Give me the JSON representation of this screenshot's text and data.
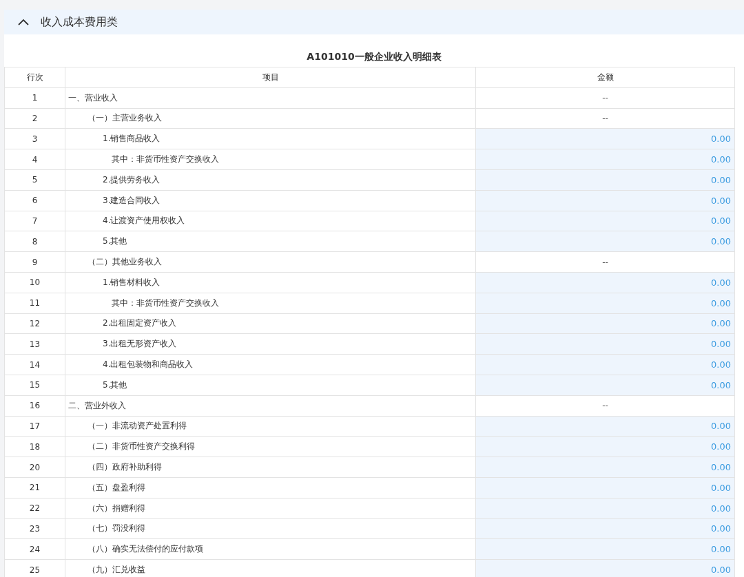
{
  "section": {
    "title": "收入成本费用类",
    "expanded": true
  },
  "table": {
    "title": "A101010一般企业收入明细表",
    "columns": [
      "行次",
      "项目",
      "金额"
    ],
    "rows": [
      {
        "no": "1",
        "item": "一、营业收入",
        "amount": "--",
        "editable": false,
        "children": [
          {
            "no": "2",
            "item": "（一）主营业务收入",
            "amount": "--",
            "editable": false,
            "children": [
              {
                "no": "3",
                "item": "1.销售商品收入",
                "amount": "0.00",
                "editable": true,
                "children": [
                  {
                    "no": "4",
                    "item": "其中：非货币性资产交换收入",
                    "amount": "0.00",
                    "editable": true
                  }
                ]
              },
              {
                "no": "5",
                "item": "2.提供劳务收入",
                "amount": "0.00",
                "editable": true
              },
              {
                "no": "6",
                "item": "3.建造合同收入",
                "amount": "0.00",
                "editable": true
              },
              {
                "no": "7",
                "item": "4.让渡资产使用权收入",
                "amount": "0.00",
                "editable": true
              },
              {
                "no": "8",
                "item": "5.其他",
                "amount": "0.00",
                "editable": true
              }
            ]
          },
          {
            "no": "9",
            "item": "（二）其他业务收入",
            "amount": "--",
            "editable": false,
            "children": [
              {
                "no": "10",
                "item": "1.销售材料收入",
                "amount": "0.00",
                "editable": true,
                "children": [
                  {
                    "no": "11",
                    "item": "其中：非货币性资产交换收入",
                    "amount": "0.00",
                    "editable": true
                  }
                ]
              },
              {
                "no": "12",
                "item": "2.出租固定资产收入",
                "amount": "0.00",
                "editable": true
              },
              {
                "no": "13",
                "item": "3.出租无形资产收入",
                "amount": "0.00",
                "editable": true
              },
              {
                "no": "14",
                "item": "4.出租包装物和商品收入",
                "amount": "0.00",
                "editable": true
              },
              {
                "no": "15",
                "item": "5.其他",
                "amount": "0.00",
                "editable": true
              }
            ]
          }
        ]
      },
      {
        "no": "16",
        "item": "二、营业外收入",
        "amount": "--",
        "editable": false,
        "children": [
          {
            "no": "17",
            "item": "（一）非流动资产处置利得",
            "amount": "0.00",
            "editable": true
          },
          {
            "no": "18",
            "item": "（二）非货币性资产交换利得",
            "amount": "0.00",
            "editable": true
          },
          {
            "no": "20",
            "item": "（四）政府补助利得",
            "amount": "0.00",
            "editable": true
          },
          {
            "no": "21",
            "item": "（五）盘盈利得",
            "amount": "0.00",
            "editable": true
          },
          {
            "no": "22",
            "item": "（六）捐赠利得",
            "amount": "0.00",
            "editable": true
          },
          {
            "no": "23",
            "item": "（七）罚没利得",
            "amount": "0.00",
            "editable": true
          },
          {
            "no": "24",
            "item": "（八）确实无法偿付的应付款项",
            "amount": "0.00",
            "editable": true
          },
          {
            "no": "25",
            "item": "（九）汇兑收益",
            "amount": "0.00",
            "editable": true
          }
        ]
      }
    ]
  }
}
